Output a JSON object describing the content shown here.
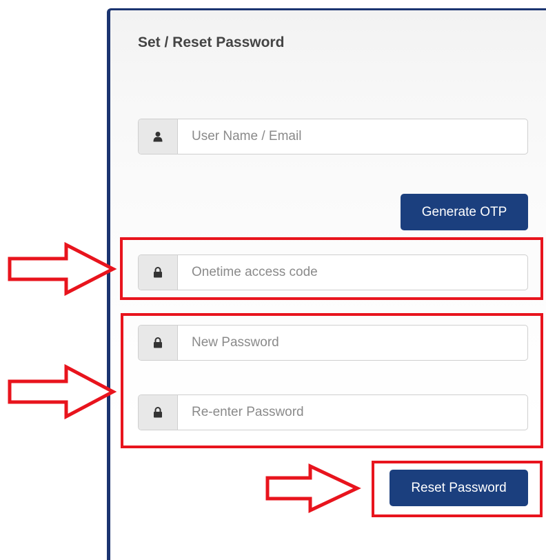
{
  "form": {
    "title": "Set / Reset Password",
    "username": {
      "placeholder": "User Name / Email",
      "icon": "user-icon"
    },
    "generate_otp_label": "Generate OTP",
    "otp": {
      "placeholder": "Onetime access code",
      "icon": "lock-icon"
    },
    "new_password": {
      "placeholder": "New Password",
      "icon": "lock-icon"
    },
    "reenter_password": {
      "placeholder": "Re-enter Password",
      "icon": "lock-icon"
    },
    "reset_password_label": "Reset Password"
  },
  "colors": {
    "primary_button": "#1b3f7e",
    "panel_border": "#1b3470",
    "annotation": "#e8141d"
  }
}
